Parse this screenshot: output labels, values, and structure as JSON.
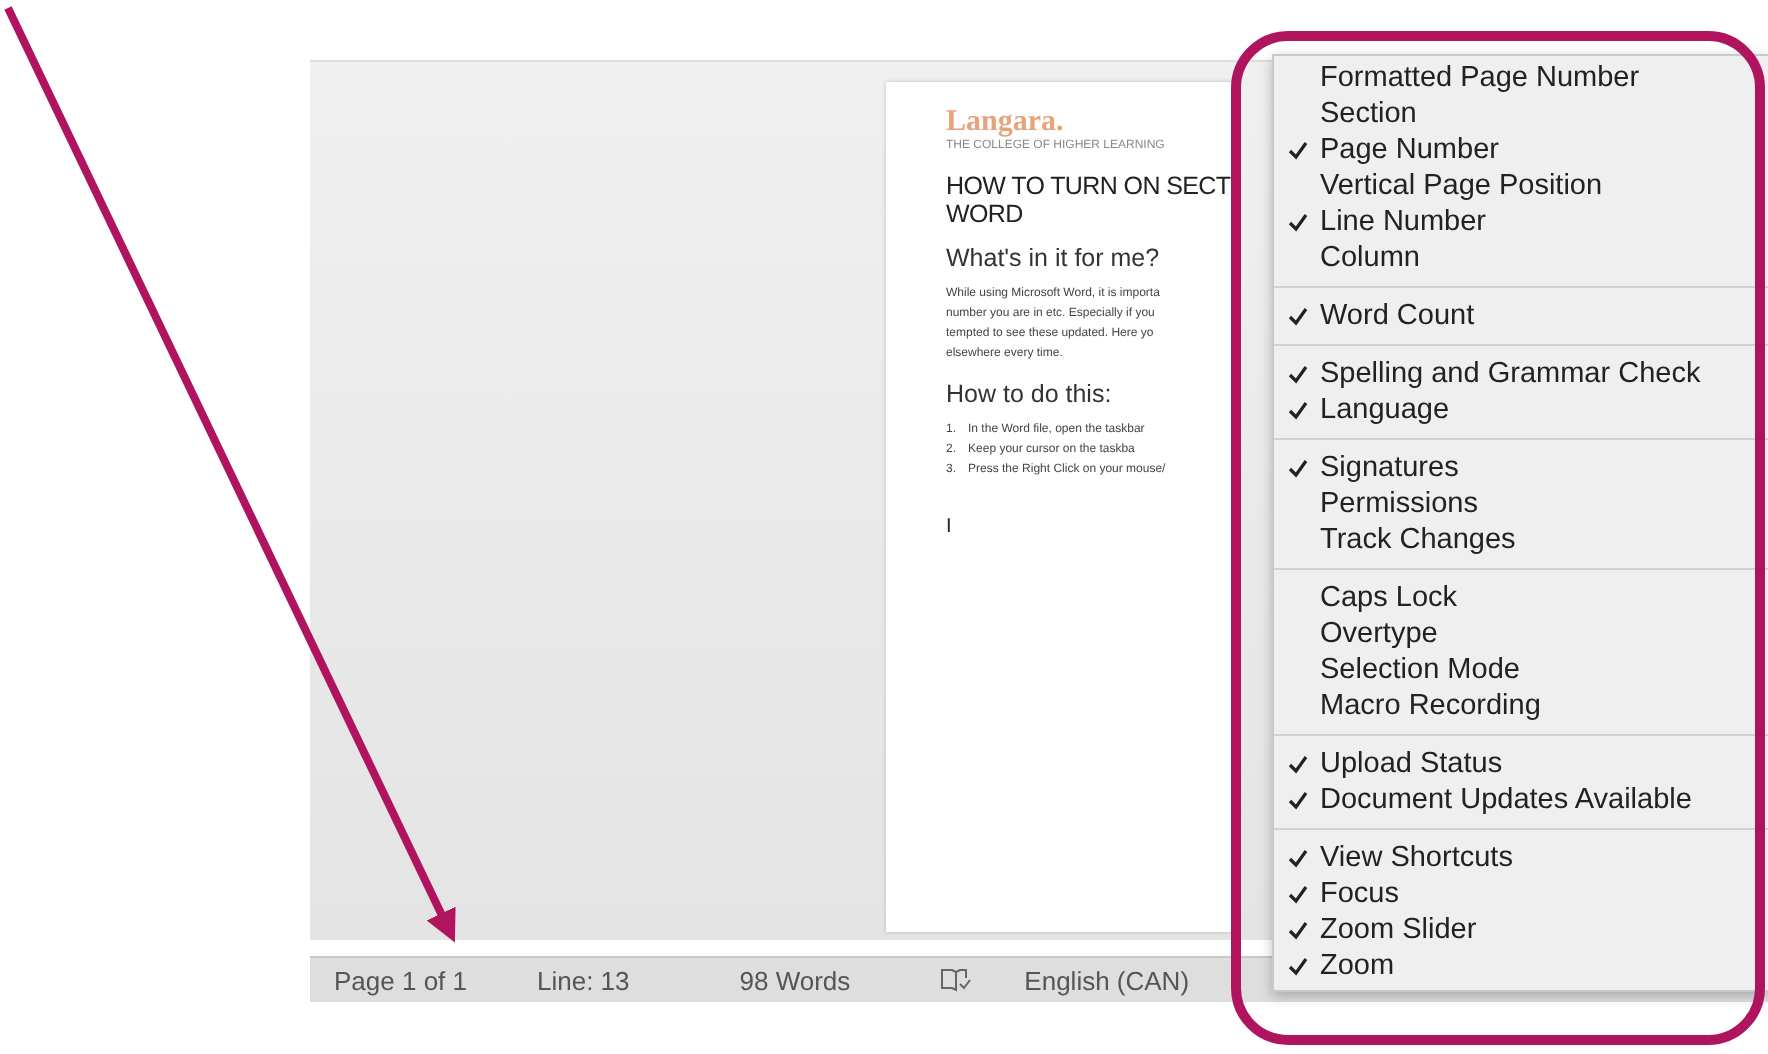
{
  "document": {
    "logo": "Langara.",
    "tagline": "THE COLLEGE OF HIGHER LEARNING",
    "title_lines": [
      "HOW TO TURN ON SECT",
      "WORD"
    ],
    "heading_1": "What's in it for me?",
    "paragraph_lines": [
      "While using Microsoft Word, it is importa",
      "number you are in etc. Especially if you",
      "tempted to see these updated. Here yo",
      "elsewhere every time."
    ],
    "heading_2": "How to do this:",
    "steps": [
      {
        "number": "1.",
        "text": "In the Word file, open the taskbar"
      },
      {
        "number": "2.",
        "text": "Keep your cursor on the taskba"
      },
      {
        "number": "3.",
        "text": "Press the Right Click on your mouse/"
      }
    ],
    "cursor": "I"
  },
  "status_bar": {
    "page": "Page 1 of 1",
    "line": "Line: 13",
    "words": "98 Words",
    "language": "English (CAN)"
  },
  "context_menu": {
    "groups": [
      [
        {
          "label": "Formatted Page Number",
          "checked": false
        },
        {
          "label": "Section",
          "checked": false
        },
        {
          "label": "Page Number",
          "checked": true
        },
        {
          "label": "Vertical Page Position",
          "checked": false
        },
        {
          "label": "Line Number",
          "checked": true
        },
        {
          "label": "Column",
          "checked": false
        }
      ],
      [
        {
          "label": "Word Count",
          "checked": true
        }
      ],
      [
        {
          "label": "Spelling and Grammar Check",
          "checked": true
        },
        {
          "label": "Language",
          "checked": true
        }
      ],
      [
        {
          "label": "Signatures",
          "checked": true
        },
        {
          "label": "Permissions",
          "checked": false
        },
        {
          "label": "Track Changes",
          "checked": false
        }
      ],
      [
        {
          "label": "Caps Lock",
          "checked": false
        },
        {
          "label": "Overtype",
          "checked": false
        },
        {
          "label": "Selection Mode",
          "checked": false
        },
        {
          "label": "Macro Recording",
          "checked": false
        }
      ],
      [
        {
          "label": "Upload Status",
          "checked": true
        },
        {
          "label": "Document Updates Available",
          "checked": true
        }
      ],
      [
        {
          "label": "View Shortcuts",
          "checked": true
        },
        {
          "label": "Focus",
          "checked": true
        },
        {
          "label": "Zoom Slider",
          "checked": true
        },
        {
          "label": "Zoom",
          "checked": true
        }
      ]
    ]
  }
}
